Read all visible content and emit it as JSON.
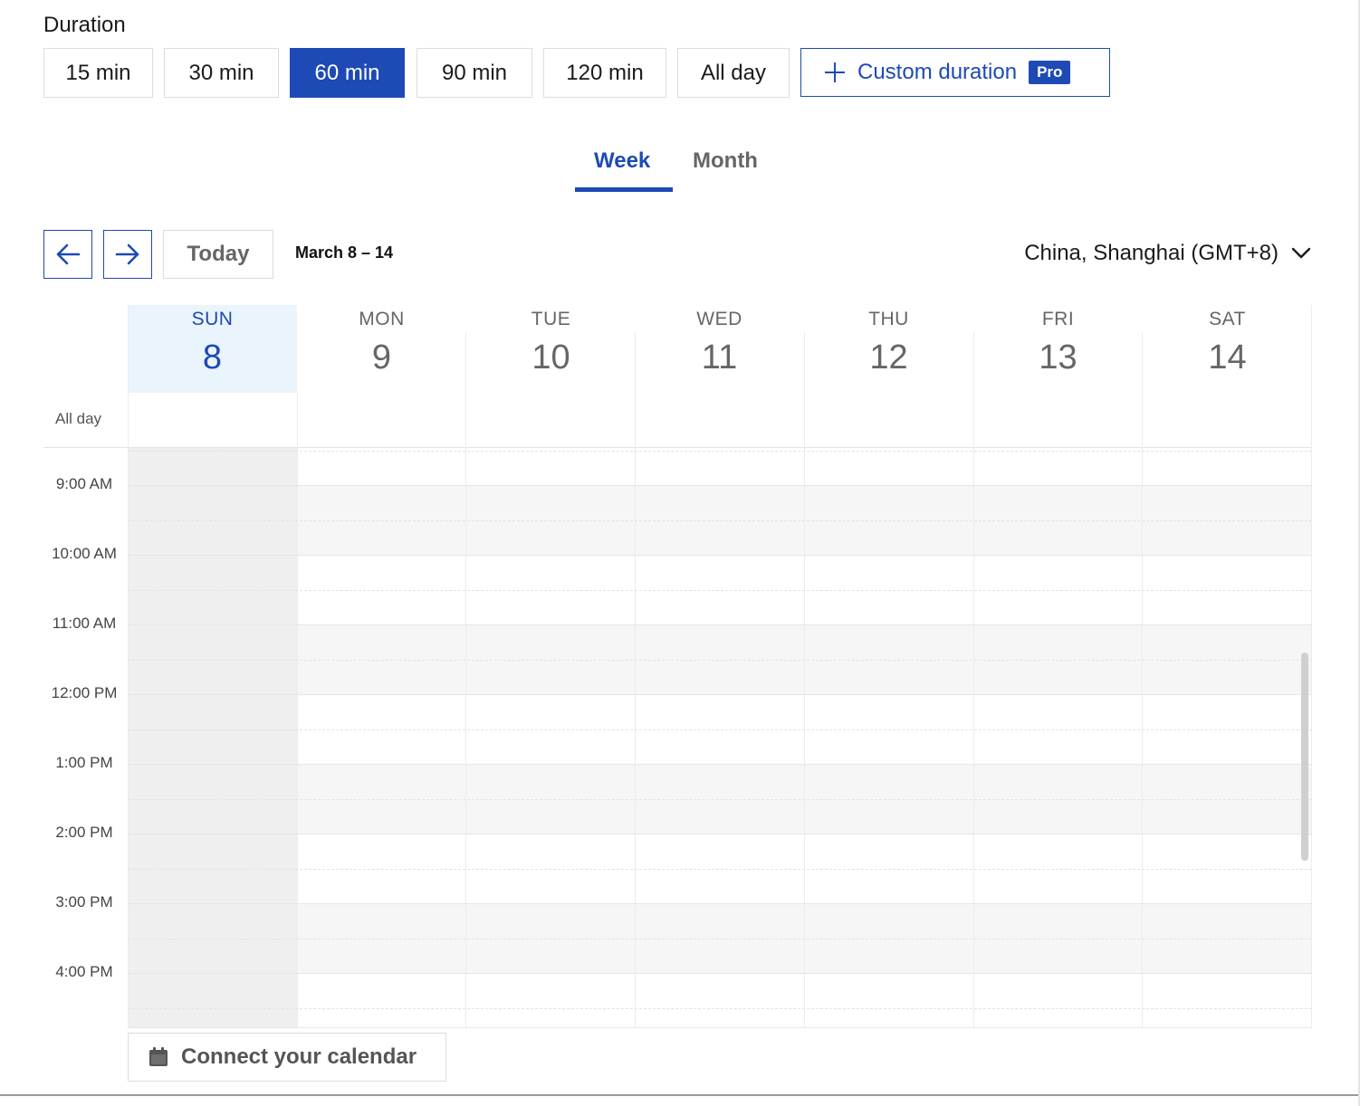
{
  "duration": {
    "label": "Duration",
    "options": [
      {
        "label": "15 min",
        "selected": false
      },
      {
        "label": "30 min",
        "selected": false
      },
      {
        "label": "60 min",
        "selected": true
      },
      {
        "label": "90 min",
        "selected": false
      },
      {
        "label": "120 min",
        "selected": false
      },
      {
        "label": "All day",
        "selected": false
      }
    ],
    "custom": {
      "label": "Custom duration",
      "badge": "Pro",
      "icon": "plus-icon"
    }
  },
  "view_tabs": {
    "week": "Week",
    "month": "Month",
    "active": "week"
  },
  "nav": {
    "prev_icon": "arrow-left-icon",
    "next_icon": "arrow-right-icon",
    "today_label": "Today",
    "range": "March 8 – 14",
    "timezone": "China, Shanghai (GMT+8)",
    "timezone_icon": "chevron-down-icon"
  },
  "calendar": {
    "days": [
      {
        "name": "SUN",
        "num": "8",
        "today": true
      },
      {
        "name": "MON",
        "num": "9",
        "today": false
      },
      {
        "name": "TUE",
        "num": "10",
        "today": false
      },
      {
        "name": "WED",
        "num": "11",
        "today": false
      },
      {
        "name": "THU",
        "num": "12",
        "today": false
      },
      {
        "name": "FRI",
        "num": "13",
        "today": false
      },
      {
        "name": "SAT",
        "num": "14",
        "today": false
      }
    ],
    "all_day_label": "All day",
    "times": [
      "9:00 AM",
      "10:00 AM",
      "11:00 AM",
      "12:00 PM",
      "1:00 PM",
      "2:00 PM",
      "3:00 PM",
      "4:00 PM"
    ]
  },
  "connect": {
    "label": "Connect your calendar",
    "icon": "calendar-icon"
  },
  "colors": {
    "accent": "#1d4ab5",
    "today_bg": "#eaf4fd"
  }
}
